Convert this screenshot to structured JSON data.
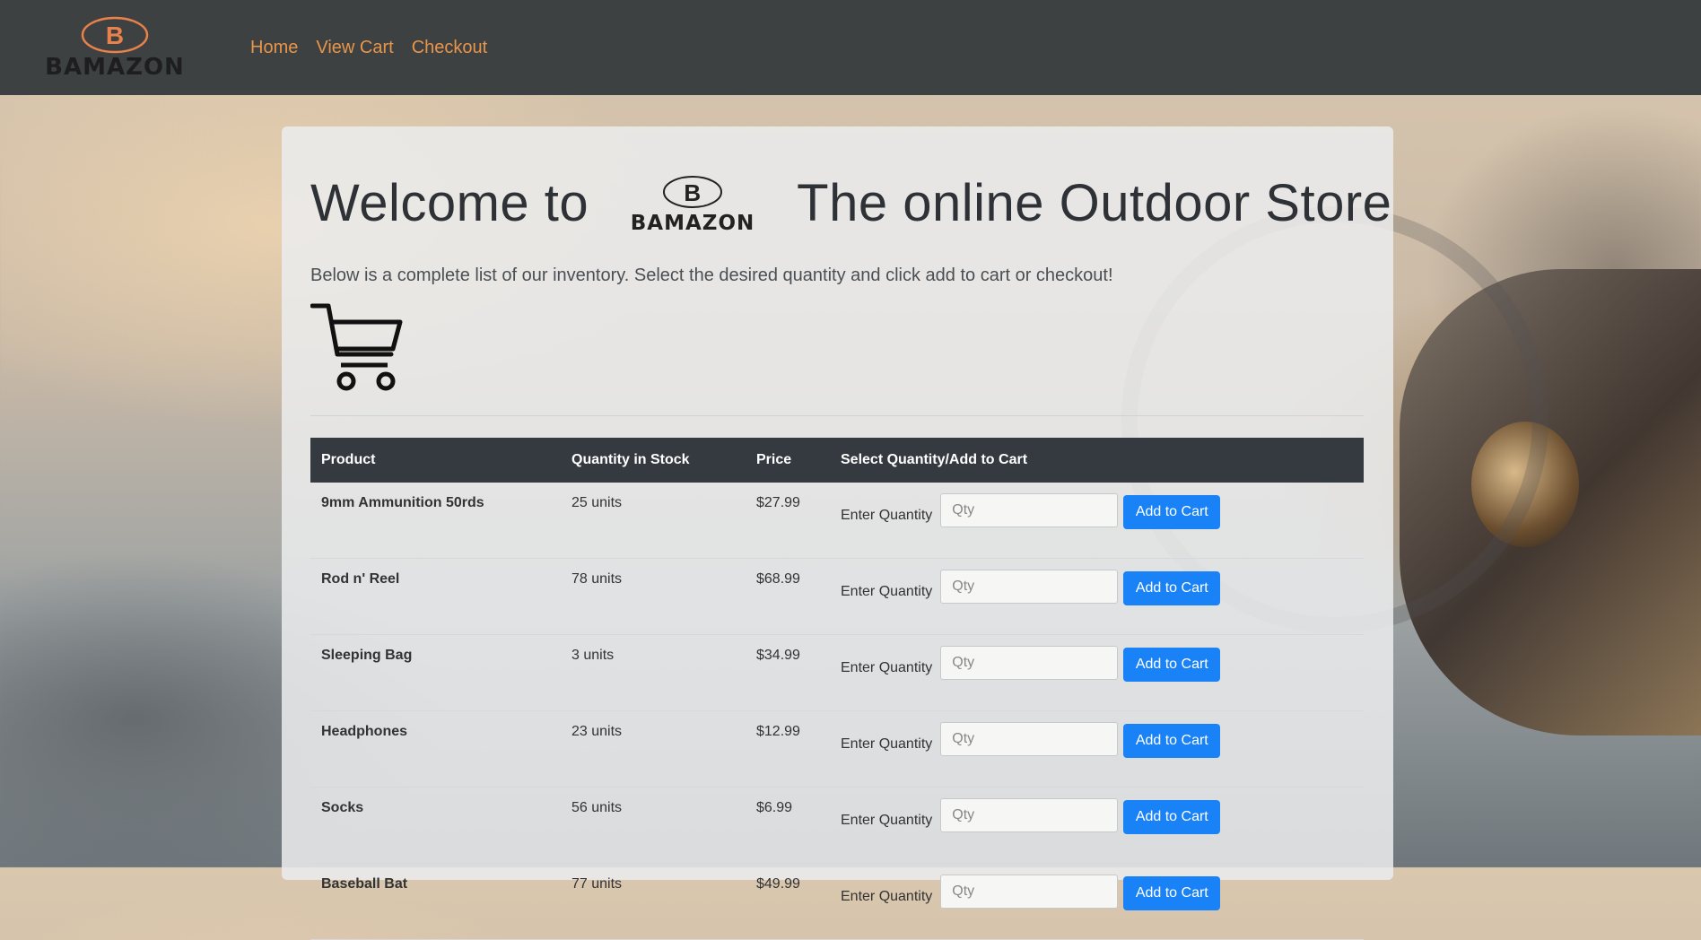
{
  "brand": {
    "logo_text": "BAMAZON",
    "logo_accent": "#e8814a"
  },
  "nav": {
    "links": [
      "Home",
      "View Cart",
      "Checkout"
    ],
    "link_color": "#e8954a"
  },
  "hero": {
    "title_prefix": "Welcome to",
    "title_suffix": "The online Outdoor Store",
    "lead": "Below is a complete list of our inventory. Select the desired quantity and click add to cart or checkout!"
  },
  "table": {
    "headers": [
      "Product",
      "Quantity in Stock",
      "Price",
      "Select Quantity/Add to Cart"
    ],
    "rows": [
      {
        "product": "9mm Ammunition 50rds",
        "stock": "25 units",
        "price": "$27.99"
      },
      {
        "product": "Rod n' Reel",
        "stock": "78 units",
        "price": "$68.99"
      },
      {
        "product": "Sleeping Bag",
        "stock": "3 units",
        "price": "$34.99"
      },
      {
        "product": "Headphones",
        "stock": "23 units",
        "price": "$12.99"
      },
      {
        "product": "Socks",
        "stock": "56 units",
        "price": "$6.99"
      },
      {
        "product": "Baseball Bat",
        "stock": "77 units",
        "price": "$49.99"
      }
    ],
    "qty_label": "Enter Quantity",
    "qty_placeholder": "Qty",
    "add_label": "Add to Cart",
    "button_color": "#1a82f7"
  }
}
